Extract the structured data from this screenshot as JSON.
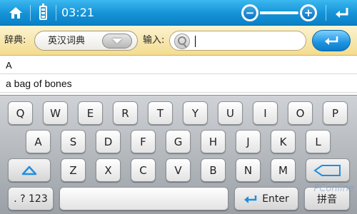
{
  "status_bar": {
    "time": "03:21",
    "zoom_minus": "−",
    "zoom_plus": "+",
    "zoom_level": 0.5
  },
  "dict_bar": {
    "dict_label": "辞典:",
    "dict_selected": "英汉词典",
    "input_label": "输入:",
    "input_value": "",
    "input_placeholder": ""
  },
  "results": [
    "A",
    "a bag of bones"
  ],
  "keyboard": {
    "row1": [
      "Q",
      "W",
      "E",
      "R",
      "T",
      "Y",
      "U",
      "I",
      "O",
      "P"
    ],
    "row2": [
      "A",
      "S",
      "D",
      "F",
      "G",
      "H",
      "J",
      "K",
      "L"
    ],
    "row3": [
      "Z",
      "X",
      "C",
      "V",
      "B",
      "N",
      "M"
    ],
    "num_label": ". ? 123",
    "enter_label": "Enter",
    "ime_label": "拼音"
  },
  "watermark": "PConline",
  "colors": {
    "accent_blue": "#1592d6",
    "dict_bar_bg": "#f3dc8f",
    "keyboard_bg": "#b4b9bf"
  }
}
